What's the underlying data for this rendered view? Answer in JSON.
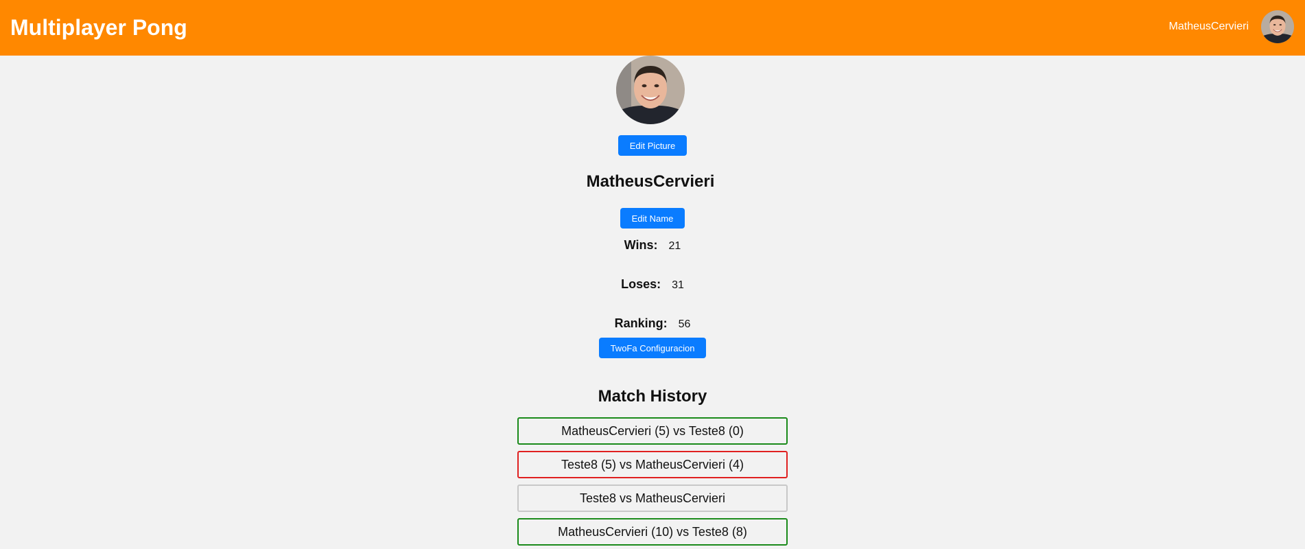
{
  "header": {
    "title": "Multiplayer Pong",
    "username": "MatheusCervieri",
    "bg_color": "#ff8800"
  },
  "profile": {
    "edit_picture_label": "Edit Picture",
    "name": "MatheusCervieri",
    "edit_name_label": "Edit Name",
    "stats": {
      "wins_label": "Wins:",
      "wins_value": "21",
      "loses_label": "Loses:",
      "loses_value": "31",
      "ranking_label": "Ranking:",
      "ranking_value": "56"
    },
    "twofa_label": "TwoFa Configuracion",
    "button_color": "#0a7cff"
  },
  "match_history": {
    "title": "Match History",
    "matches": [
      {
        "text": "MatheusCervieri (5) vs Teste8 (0)",
        "result": "win",
        "border_color": "#1a8a1a"
      },
      {
        "text": "Teste8 (5) vs MatheusCervieri (4)",
        "result": "loss",
        "border_color": "#e02020"
      },
      {
        "text": "Teste8 vs MatheusCervieri",
        "result": "pending",
        "border_color": "#c8c8c8"
      },
      {
        "text": "MatheusCervieri (10) vs Teste8 (8)",
        "result": "win",
        "border_color": "#1a8a1a"
      }
    ]
  }
}
